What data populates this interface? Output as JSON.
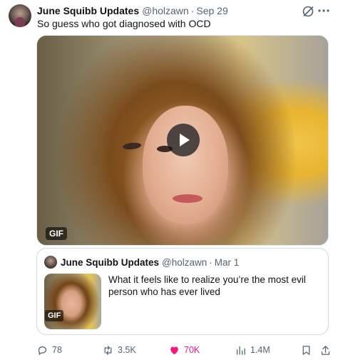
{
  "post": {
    "author_name": "June Squibb Updates",
    "handle": "@holzawn",
    "separator": "·",
    "date": "Sep 29",
    "text": "So guess who got diagnosed with OCD",
    "media_badge": "GIF"
  },
  "quote": {
    "author_name": "June Squibb Updates",
    "handle": "@holzawn",
    "separator": "·",
    "date": "Mar 1",
    "text": "What it feels like to realize you’re the most evil person who has ever lived",
    "media_badge": "GIF"
  },
  "actions": {
    "replies": "78",
    "retweets": "3.5K",
    "likes": "70K",
    "views": "1.4M"
  },
  "colors": {
    "text": "#0f1419",
    "muted": "#536471",
    "like_active": "#f91880",
    "border": "#cfd9de"
  },
  "icons": [
    "grok-icon",
    "more-icon",
    "play-icon",
    "reply-icon",
    "retweet-icon",
    "heart-icon",
    "views-icon",
    "bookmark-icon",
    "share-icon"
  ]
}
